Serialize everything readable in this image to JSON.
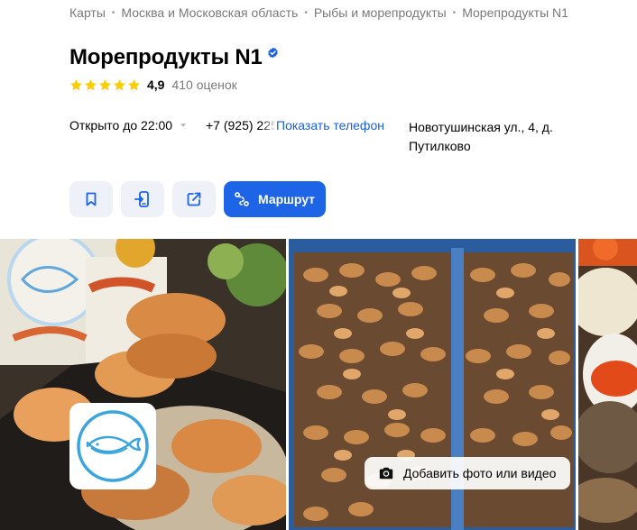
{
  "breadcrumb": {
    "items": [
      "Карты",
      "Москва и Московская область",
      "Рыбы и морепродукты",
      "Морепродукты N1"
    ]
  },
  "place": {
    "title": "Морепродукты N1",
    "verified_icon": "verified-check-icon",
    "rating": "4,9",
    "rating_stars": 5,
    "reviews": "410 оценок"
  },
  "info": {
    "open_status": "Открыто до 22:00",
    "phone": "+7 (925) 225",
    "show_phone": "Показать телефон",
    "address": "Новотушинская ул., 4, д. Путилково"
  },
  "actions": {
    "bookmark_icon": "bookmark-icon",
    "send_to_phone_icon": "send-to-phone-icon",
    "share_icon": "share-icon",
    "route_label": "Маршрут",
    "route_icon": "route-icon"
  },
  "gallery": {
    "add_photo_label": "Добавить фото или видео",
    "camera_icon": "camera-icon"
  },
  "colors": {
    "accent": "#1e64e6",
    "link": "#1b5fdb",
    "star": "#ffcc00",
    "secondary_text": "#7a7a7a",
    "button_bg": "#eef1f8"
  }
}
